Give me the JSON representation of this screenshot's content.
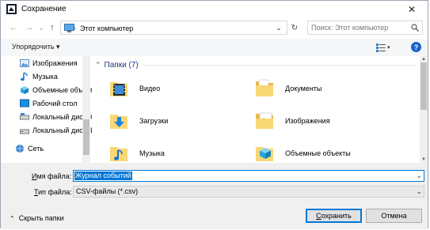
{
  "window": {
    "title": "Сохранение",
    "close_glyph": "✕"
  },
  "nav": {
    "back_glyph": "←",
    "forward_glyph": "→",
    "recent_glyph": "⌄",
    "up_glyph": "↑",
    "address_path": "Этот компьютер",
    "address_sep": "›",
    "dropdown_glyph": "⌄",
    "refresh_glyph": "↻",
    "search_placeholder": "Поиск: Этот компьютер"
  },
  "toolbar": {
    "organize_label": "Упорядочить ▾",
    "help_label": "?"
  },
  "sidebar": {
    "items": [
      {
        "label": "Изображения",
        "icon": "pictures-icon"
      },
      {
        "label": "Музыка",
        "icon": "music-icon"
      },
      {
        "label": "Объемные объекты",
        "icon": "3d-objects-icon"
      },
      {
        "label": "Рабочий стол",
        "icon": "desktop-icon"
      },
      {
        "label": "Локальный диск (C:)",
        "icon": "drive-icon"
      },
      {
        "label": "Локальный диск (D:)",
        "icon": "drive-icon"
      },
      {
        "label": "Сеть",
        "icon": "network-icon"
      }
    ]
  },
  "content": {
    "section_title": "Папки (7)",
    "section_chevron": "⌃",
    "folders": [
      {
        "label": "Видео",
        "icon": "videos-folder-icon"
      },
      {
        "label": "Документы",
        "icon": "documents-folder-icon"
      },
      {
        "label": "Загрузки",
        "icon": "downloads-folder-icon"
      },
      {
        "label": "Изображения",
        "icon": "pictures-folder-icon"
      },
      {
        "label": "Музыка",
        "icon": "music-folder-icon"
      },
      {
        "label": "Объемные объекты",
        "icon": "3d-objects-folder-icon"
      }
    ]
  },
  "form": {
    "filename_label_u": "И",
    "filename_label_rest": "мя файла:",
    "filename_value": "Журнал событий",
    "filetype_label_u": "Т",
    "filetype_label_rest": "ип файла:",
    "filetype_value": "CSV-файлы (*.csv)",
    "hide_folders_label": "Скрыть папки",
    "save_label_u": "С",
    "save_label_rest": "охранить",
    "cancel_label": "Отмена",
    "dropdown_glyph": "⌄"
  },
  "colors": {
    "accent": "#0078d7",
    "folder_yellow": "#f8d775",
    "section_title": "#1e3287"
  }
}
